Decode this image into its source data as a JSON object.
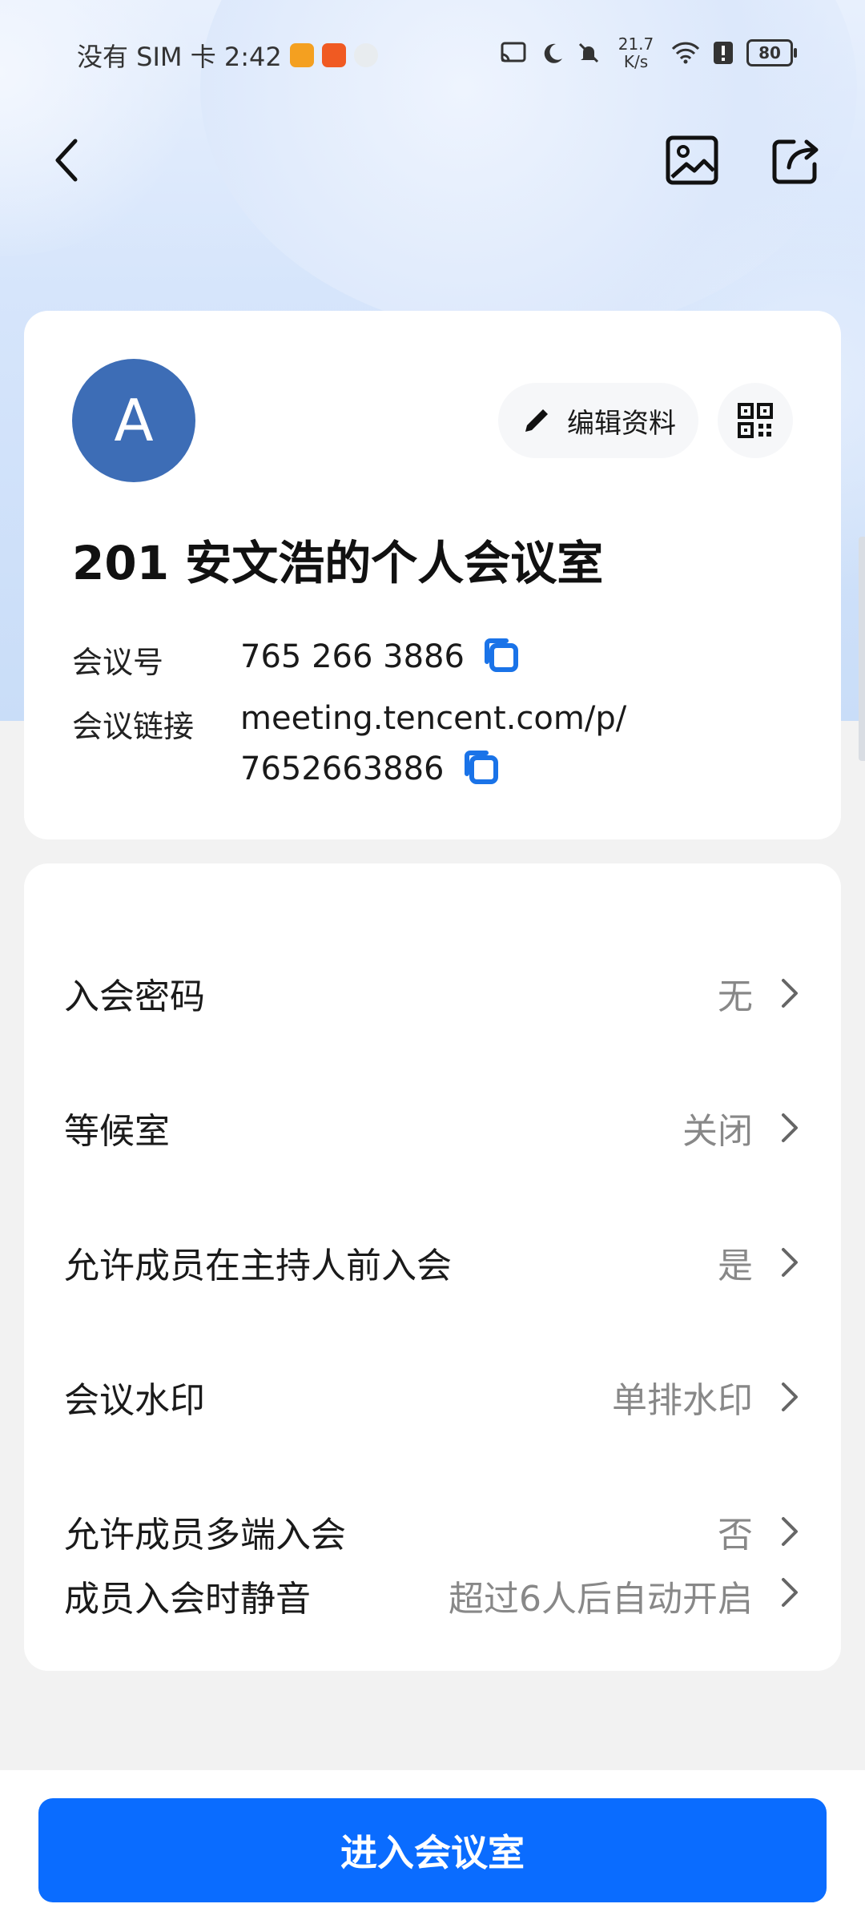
{
  "status_bar": {
    "carrier_time": "没有 SIM 卡 2:42",
    "net_speed_value": "21.7",
    "net_speed_unit": "K/s",
    "battery": "80"
  },
  "profile": {
    "avatar_letter": "A",
    "avatar_color": "#3d6db6",
    "edit_label": "编辑资料",
    "room_title": "201 安文浩的个人会议室",
    "meeting_id_label": "会议号",
    "meeting_id": "765 266 3886",
    "link_label": "会议链接",
    "link_line1": "meeting.tencent.com/p/",
    "link_line2": "7652663886"
  },
  "settings": [
    {
      "label": "入会密码",
      "value": "无"
    },
    {
      "label": "等候室",
      "value": "关闭"
    },
    {
      "label": "允许成员在主持人前入会",
      "value": "是"
    },
    {
      "label": "会议水印",
      "value": "单排水印"
    },
    {
      "label": "允许成员多端入会",
      "value": "否"
    },
    {
      "label": "成员入会时静音",
      "value": "超过6人后自动开启"
    }
  ],
  "actions": {
    "enter_room": "进入会议室"
  },
  "colors": {
    "primary": "#0a6cff",
    "copy_icon": "#1a73e8"
  }
}
